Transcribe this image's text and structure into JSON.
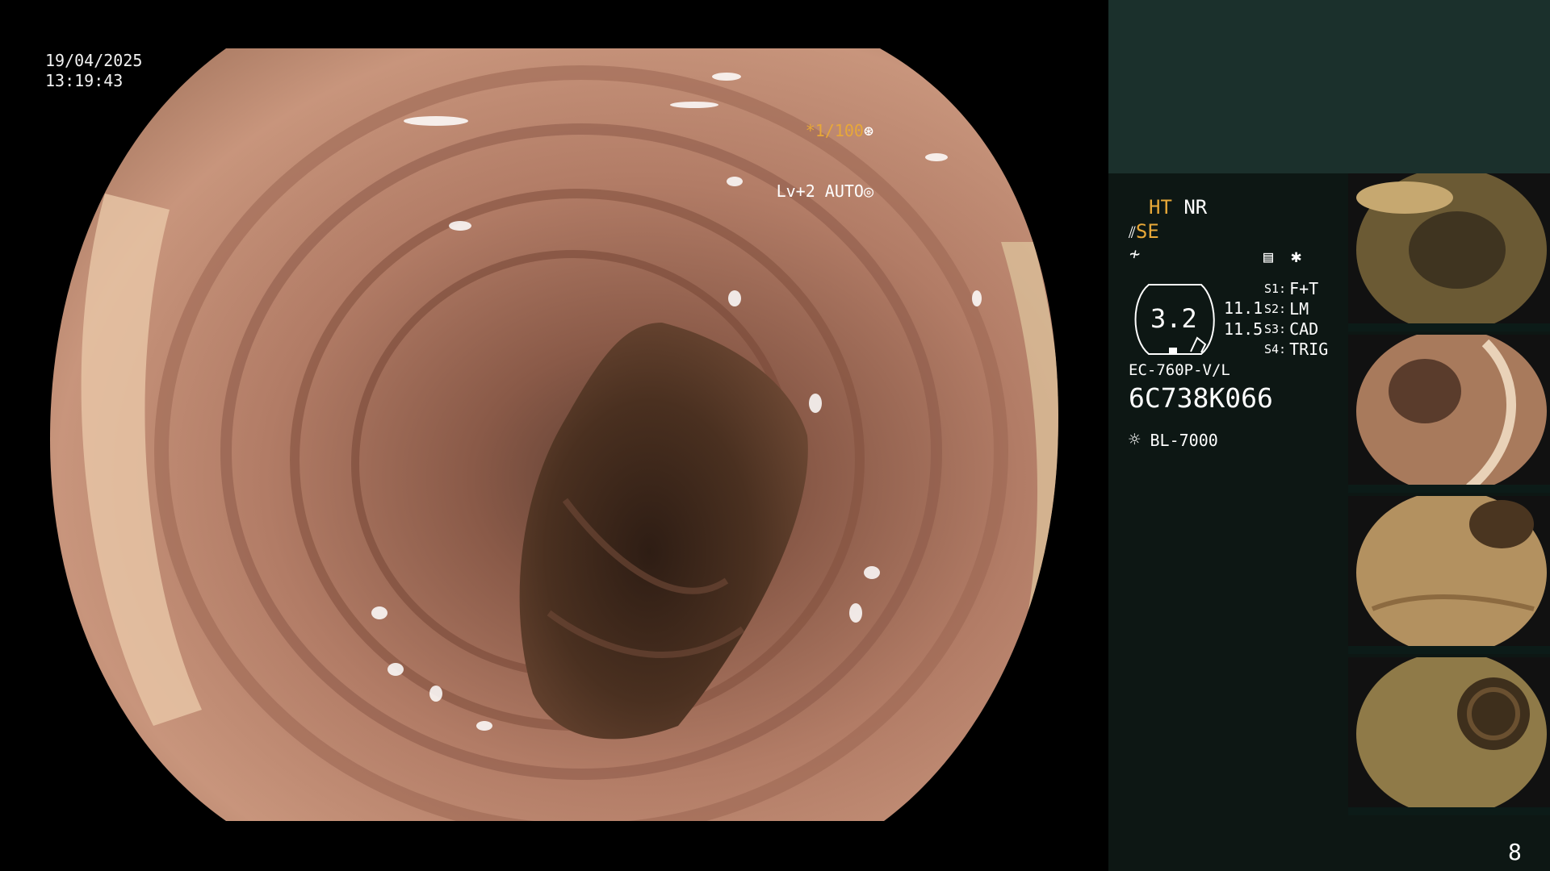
{
  "osd": {
    "date": "19/04/2025",
    "time": "13:19:43",
    "shutter": "*1/100",
    "light_level": "Lv+2 AUTO"
  },
  "panel": {
    "ht": "HT",
    "nr": "NR",
    "se": "SE",
    "zoom": "3.2",
    "val1": "11.1",
    "val2": "11.5",
    "modes": [
      {
        "key": "S1:",
        "value": "F+T"
      },
      {
        "key": "S2:",
        "value": "LM"
      },
      {
        "key": "S3:",
        "value": "CAD"
      },
      {
        "key": "S4:",
        "value": "TRIG"
      }
    ],
    "scope_model": "EC-760P-V/L",
    "scope_serial": "6C738K066",
    "light_source": "BL-7000",
    "image_count": "8",
    "icons": [
      "sun-icon",
      "record-icon",
      "star-icon",
      "trigger-icon",
      "freeze-icon"
    ]
  },
  "colors": {
    "panel_bg": "#0d1714",
    "panel_top_bg": "#1b302c",
    "accent": "#e8a838"
  }
}
